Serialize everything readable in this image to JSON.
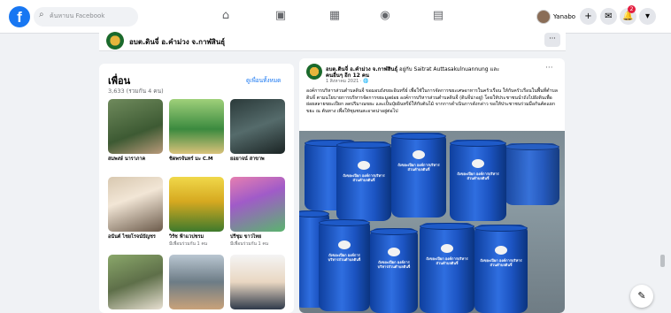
{
  "topbar": {
    "logo": "f",
    "search_placeholder": "ค้นหาบน Facebook",
    "profile_name": "Yanabo",
    "notif_count": "2",
    "nav_icons": [
      "home-icon",
      "watch-icon",
      "marketplace-icon",
      "groups-icon",
      "gaming-icon"
    ]
  },
  "page_header": {
    "name": "อบต.ดินจี่ อ.คำม่วง จ.กาฬสินธุ์",
    "more": "···"
  },
  "friends": {
    "title": "เพื่อน",
    "count": "3,633 (รวมกัน 4 คน)",
    "see_all": "ดูเพื่อนทั้งหมด",
    "items": [
      {
        "name": "สมพงษ์ นาราภาค",
        "sub": ""
      },
      {
        "name": "ชิดพรจันทร์ มะ C.M",
        "sub": ""
      },
      {
        "name": "ยอยาจน์ สาขาพ",
        "sub": ""
      },
      {
        "name": "อนันต์ ไชยโรจน์บัญชร",
        "sub": ""
      },
      {
        "name": "วิรัช ฟ้าแวปชรม",
        "sub": "มีเพื่อนร่วมกัน 1 คน"
      },
      {
        "name": "ปรีชุม ขาวไทย",
        "sub": "มีเพื่อนร่วมกัน 1 คน"
      },
      {
        "name": "",
        "sub": ""
      },
      {
        "name": "",
        "sub": ""
      },
      {
        "name": "",
        "sub": ""
      }
    ]
  },
  "post": {
    "author": "อบต.ดินจี่ อ.คำม่วง จ.กาฬสินธุ์",
    "with_text": "อยู่กับ Saitrat Auttasakulnuannung และ",
    "others": "คนอื่นๆ อีก 12 คน",
    "date": "1 สิงหาคม 2021 · 🌐",
    "more": "···",
    "body": "องค์การบริหารส่วนตำบลดินจี่ ขอมอบถังขยะอินทรีย์ เพื่อใช้ในการจัดการขยะเศษอาหารในครัวเรือน ให้กับครัวเรือนในพื้นที่ตำบลดินจี่ ตามนโยบายการบริหารจัดการขยะมูลฝอย องค์การบริหารส่วนตำบลดินจี่ (ดินจี่น่าอยู่) โดยให้ประชาชนนำถังไปฝังดินเพื่อย่อยสลายขยะเปียก ลดปริมาณขยะ และเป็นปุ๋ยอินทรีย์ให้กับต้นไม้ จากการดำเนินการดังกล่าว ขอให้ประชาชนร่วมมือกันคัดแยกขยะ ณ ต้นทาง เพื่อให้ชุมชนสะอาดน่าอยู่ต่อไป",
    "barrel_text": "ถังขยะเปียก องค์การบริหารส่วนตำบลดินจี่"
  },
  "colors": {
    "brand": "#1877f2",
    "barrel_blue": "#1c54c2"
  }
}
